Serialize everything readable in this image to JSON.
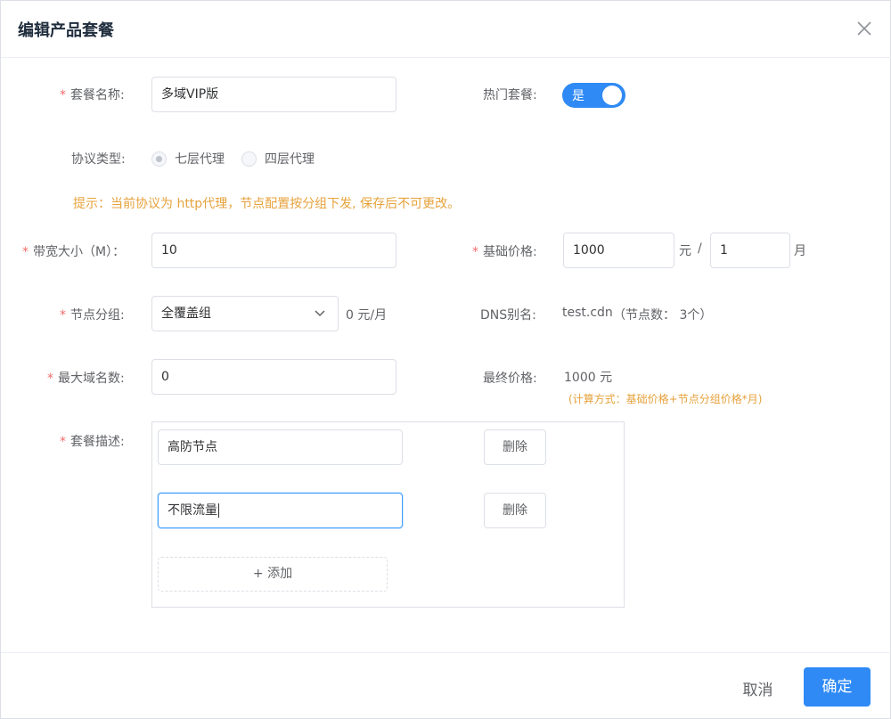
{
  "dialog": {
    "title": "编辑产品套餐",
    "close_icon": "close-icon"
  },
  "form": {
    "package_name": {
      "required": "*",
      "label": "套餐名称:",
      "value": "多域VIP版"
    },
    "hot": {
      "label": "热门套餐:",
      "switch_text": "是",
      "on": true
    },
    "protocol": {
      "label": "协议类型:",
      "options": [
        {
          "label": "七层代理",
          "checked": true
        },
        {
          "label": "四层代理",
          "checked": false
        }
      ]
    },
    "hint": "提示：当前协议为 http代理，节点配置按分组下发, 保存后不可更改。",
    "bandwidth": {
      "required": "*",
      "label": "带宽大小（M）：",
      "value": "10"
    },
    "base_price": {
      "required": "*",
      "label": "基础价格:",
      "value": "1000",
      "unit": "元",
      "separator": "/",
      "period_value": "1",
      "period_unit": "月"
    },
    "node_group": {
      "required": "*",
      "label": "节点分组:",
      "selected": "全覆盖组",
      "price": "0 元/月"
    },
    "dns_alias": {
      "label": "DNS别名:",
      "value": "test.cdn",
      "node_count": "（节点数： 3个）"
    },
    "max_domains": {
      "required": "*",
      "label": "最大域名数:",
      "value": "0"
    },
    "final_price": {
      "label": "最终价格:",
      "value": "1000 元",
      "formula": "(计算方式：基础价格+节点分组价格*月)"
    },
    "description": {
      "required": "*",
      "label": "套餐描述:",
      "items": [
        {
          "value": "高防节点",
          "delete_label": "删除"
        },
        {
          "value": "不限流量",
          "delete_label": "删除"
        }
      ],
      "add_label": "+   添加"
    }
  },
  "footer": {
    "cancel_label": "取消",
    "ok_label": "确定"
  },
  "colors": {
    "primary": "#2f8af5",
    "warning": "#e6a23c",
    "required": "#f56c6c"
  }
}
